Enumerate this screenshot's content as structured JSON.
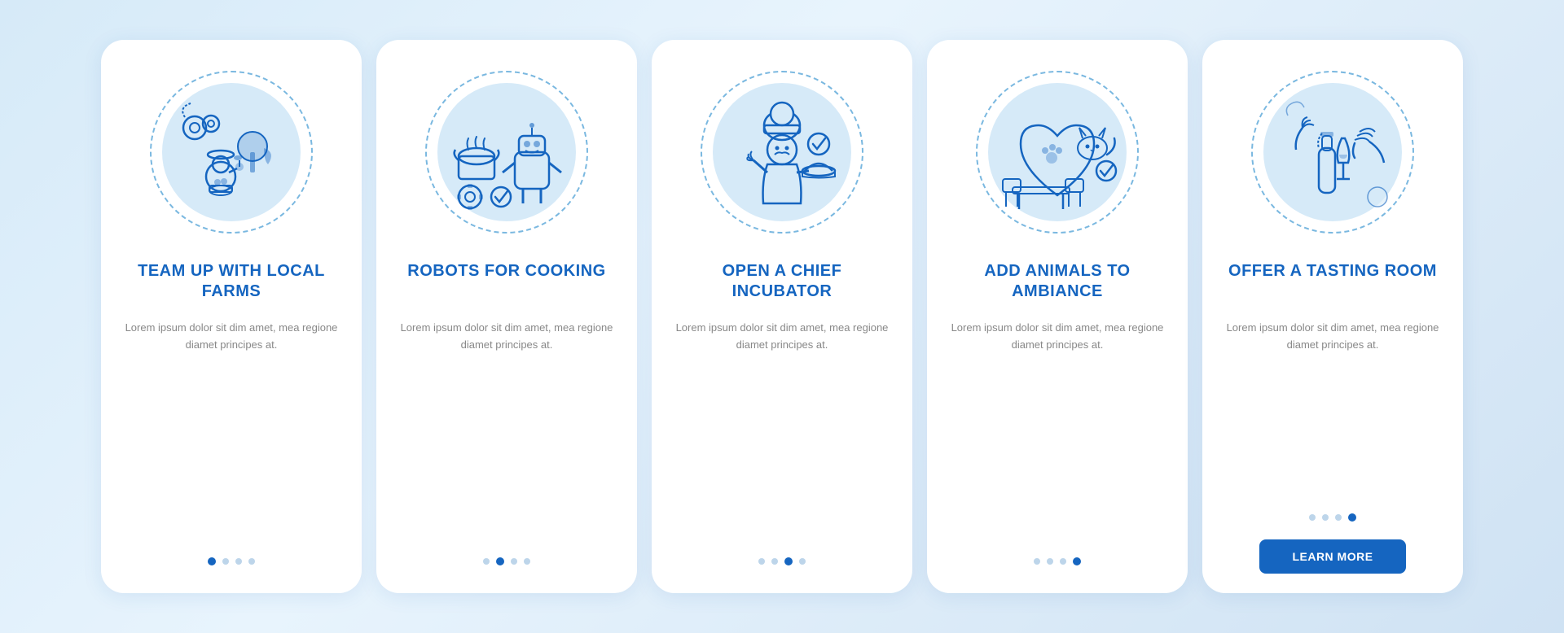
{
  "cards": [
    {
      "id": "card-1",
      "title": "TEAM UP WITH LOCAL FARMS",
      "description": "Lorem ipsum dolor sit dim amet, mea regione diamet principes at.",
      "dots": [
        true,
        false,
        false,
        false
      ],
      "active_dot": 0,
      "illustration": "farm",
      "show_button": false
    },
    {
      "id": "card-2",
      "title": "ROBOTS FOR COOKING",
      "description": "Lorem ipsum dolor sit dim amet, mea regione diamet principes at.",
      "dots": [
        false,
        true,
        false,
        false
      ],
      "active_dot": 1,
      "illustration": "robot",
      "show_button": false
    },
    {
      "id": "card-3",
      "title": "OPEN A CHIEF INCUBATOR",
      "description": "Lorem ipsum dolor sit dim amet, mea regione diamet principes at.",
      "dots": [
        false,
        false,
        true,
        false
      ],
      "active_dot": 2,
      "illustration": "chef",
      "show_button": false
    },
    {
      "id": "card-4",
      "title": "ADD ANIMALS TO AMBIANCE",
      "description": "Lorem ipsum dolor sit dim amet, mea regione diamet principes at.",
      "dots": [
        false,
        false,
        false,
        true
      ],
      "active_dot": 3,
      "illustration": "animals",
      "show_button": false
    },
    {
      "id": "card-5",
      "title": "OFFER A TASTING ROOM",
      "description": "Lorem ipsum dolor sit dim amet, mea regione diamet principes at.",
      "dots": [
        false,
        false,
        false,
        true
      ],
      "active_dot": 3,
      "illustration": "tasting",
      "show_button": true,
      "button_label": "LEARN MORE"
    }
  ]
}
